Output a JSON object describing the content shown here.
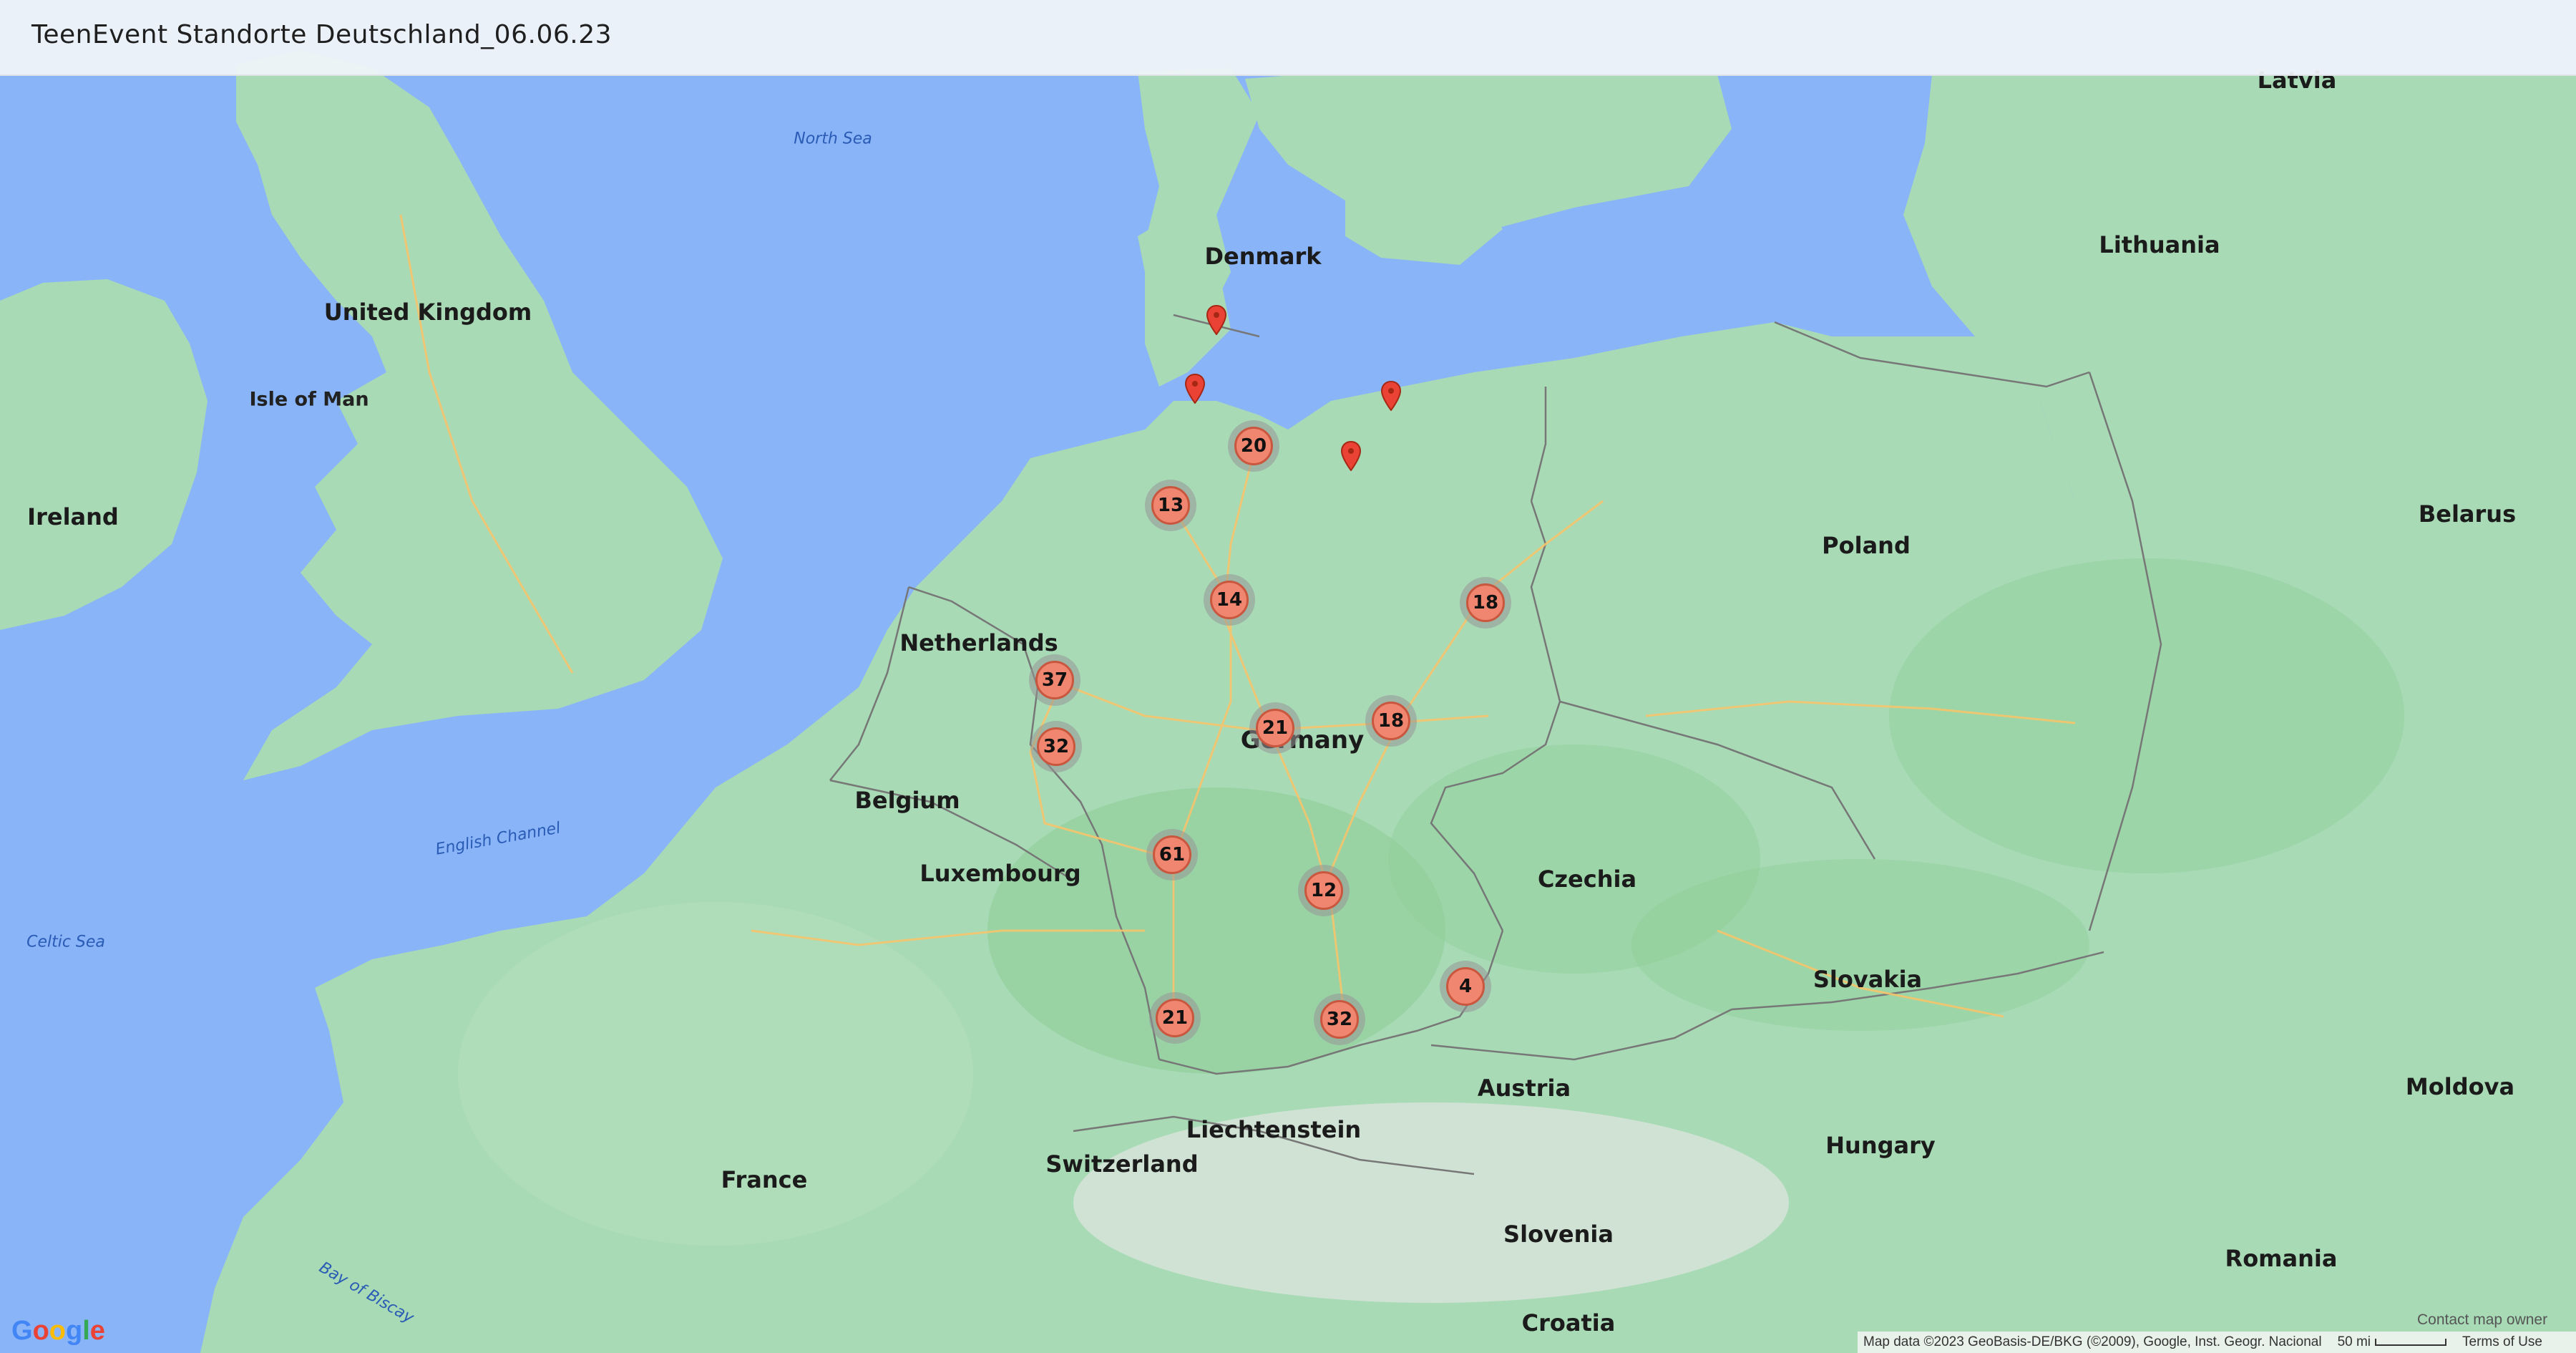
{
  "title": "TeenEvent Standorte Deutschland_06.06.23",
  "attribution": {
    "map_data": "Map data ©2023 GeoBasis-DE/BKG (©2009), Google, Inst. Geogr. Nacional",
    "scale": "50 mi",
    "terms": "Terms of Use",
    "contact": "Contact map owner"
  },
  "google_logo": "Google",
  "marker_color": "#f0866f",
  "clusters": [
    {
      "count": "20",
      "near": "Hamburg"
    },
    {
      "count": "13",
      "near": "Bremen"
    },
    {
      "count": "14",
      "near": "Hanover"
    },
    {
      "count": "18",
      "near": "Berlin"
    },
    {
      "count": "37",
      "near": "Essen"
    },
    {
      "count": "32",
      "near": "Cologne"
    },
    {
      "count": "21",
      "near": "Kassel"
    },
    {
      "count": "18",
      "near": "Leipzig"
    },
    {
      "count": "61",
      "near": "Frankfurt"
    },
    {
      "count": "12",
      "near": "Nuremberg"
    },
    {
      "count": "4",
      "near": "Passau"
    },
    {
      "count": "21",
      "near": "Freiburg"
    },
    {
      "count": "32",
      "near": "Munich"
    }
  ],
  "pins": [
    {
      "near": "Flensburg"
    },
    {
      "near": "Sylt"
    },
    {
      "near": "Rostock"
    },
    {
      "near": "Schwerin"
    }
  ],
  "labels": {
    "countries": [
      "Denmark",
      "Germany",
      "Netherlands",
      "Belgium",
      "Luxembourg",
      "France",
      "Switzerland",
      "Liechtenstein",
      "Austria",
      "Czechia",
      "Poland",
      "Lithuania",
      "Latvia",
      "Belarus",
      "Slovakia",
      "Hungary",
      "Romania",
      "Moldova",
      "Slovenia",
      "Croatia",
      "Ireland",
      "United Kingdom",
      "Isle of Man"
    ],
    "water": [
      "North Sea",
      "English Channel",
      "Celtic Sea",
      "Bay of Biscay"
    ]
  }
}
